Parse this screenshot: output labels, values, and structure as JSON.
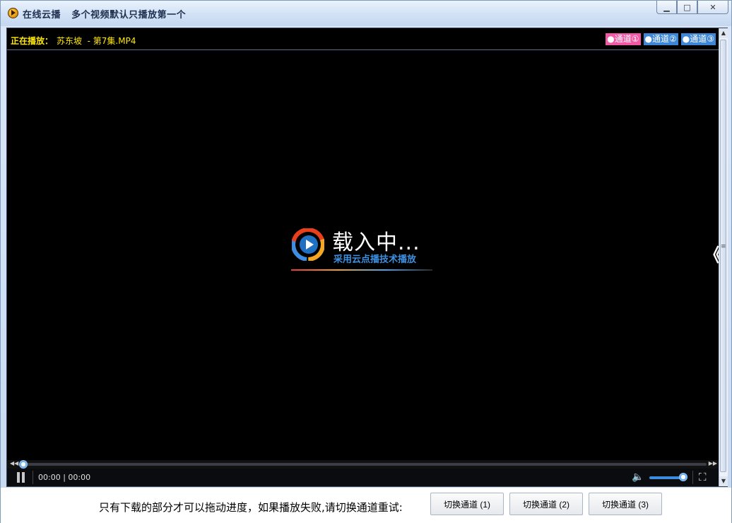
{
  "window": {
    "title": "在线云播   多个视频默认只播放第一个",
    "icon": "cloud-play-app-icon",
    "buttons": {
      "minimize": "▁",
      "maximize": "□",
      "close": "✕"
    }
  },
  "player": {
    "now_playing_label": "正在播放：",
    "now_playing_file": "苏东坡  - 第7集.MP4",
    "channels": [
      "●通道①",
      "●通道②",
      "●通道③"
    ],
    "loading_text": "载入中...",
    "loading_subtitle": "采用云点播技术播放",
    "side_arrow": "《",
    "time": "00:00 | 00:00",
    "progress": 0,
    "volume": 0.85,
    "colors": {
      "accent": "#3d8ee0",
      "channel_active": "#f05aa5",
      "channel": "#3d87d6",
      "now_playing": "#ffe800"
    }
  },
  "footer": {
    "hint": "只有下载的部分才可以拖动进度，如果播放失败,请切换通道重试:",
    "switch_buttons": [
      "切换通道 (1)",
      "切换通道 (2)",
      "切换通道 (3)"
    ]
  }
}
